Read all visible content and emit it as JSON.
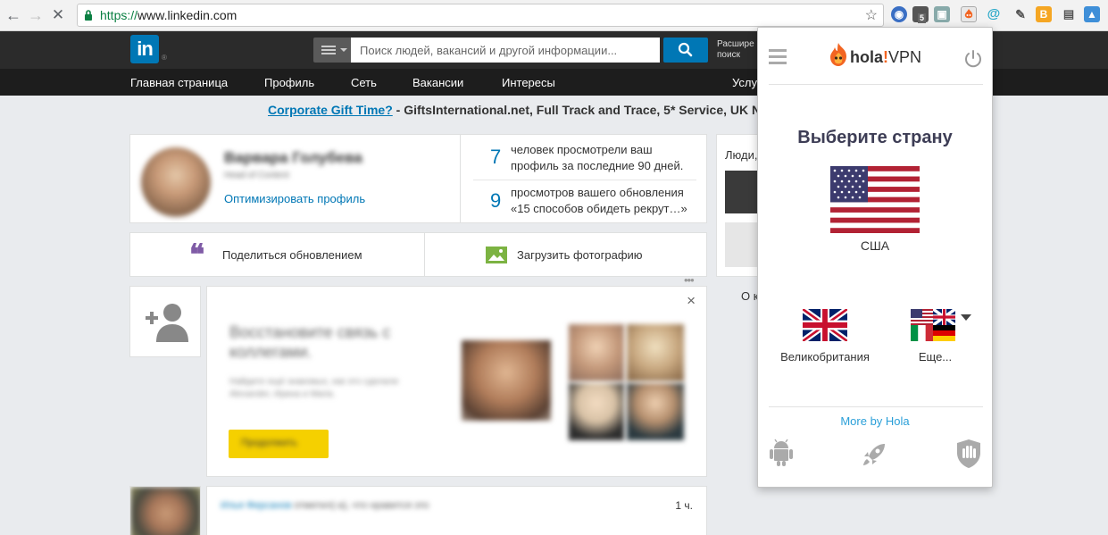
{
  "browser": {
    "url_scheme": "https://",
    "url_host": "www.linkedin.com",
    "extension_badge": "5"
  },
  "linkedin": {
    "logo_text": "in",
    "logo_registered": "®",
    "search_placeholder": "Поиск людей, вакансий и другой информации...",
    "advanced_search": "Расшире поиск",
    "nav": [
      "Главная страница",
      "Профиль",
      "Сеть",
      "Вакансии",
      "Интересы",
      "Услу"
    ],
    "banner_link": "Corporate Gift Time?",
    "banner_text": " - GiftsInternational.net, Full Track and Trace, 5* Service, UK N",
    "profile": {
      "name": "Варвара Голубева",
      "headline": "Head of Content",
      "optimize_link": "Оптимизировать профиль"
    },
    "stats": [
      {
        "value": "7",
        "text": "человек просмотрели ваш профиль за последние 90 дней."
      },
      {
        "value": "9",
        "text": "просмотров вашего обновления «15 способов обидеть рекрут…»"
      }
    ],
    "share_update": "Поделиться обновлением",
    "upload_photo": "Загрузить фотографию",
    "reconnect": {
      "title": "Восстановите связь с коллегами.",
      "body": "Найдите ещё знакомых, как это сделали Alexander, Ирина и Maria.",
      "button": "Продолжить",
      "close": "×"
    },
    "feed_item": {
      "author": "Илья Ферсанов",
      "action": " отметил(-а), что нравится это",
      "time": "1 ч."
    },
    "people_label": "Люди,",
    "bottom_label": "О к"
  },
  "hola": {
    "brand_hola": "hola",
    "brand_bang": "!",
    "brand_vpn": "VPN",
    "choose_country": "Выберите страну",
    "selected_country": "США",
    "option_uk": "Великобритания",
    "option_more": "Еще...",
    "more_by_hola": "More by Hola"
  },
  "colors": {
    "linkedin_blue": "#0077b5",
    "hola_orange": "#f26522",
    "hola_blue": "#2a9fd8",
    "yellow_button": "#f5d000"
  }
}
